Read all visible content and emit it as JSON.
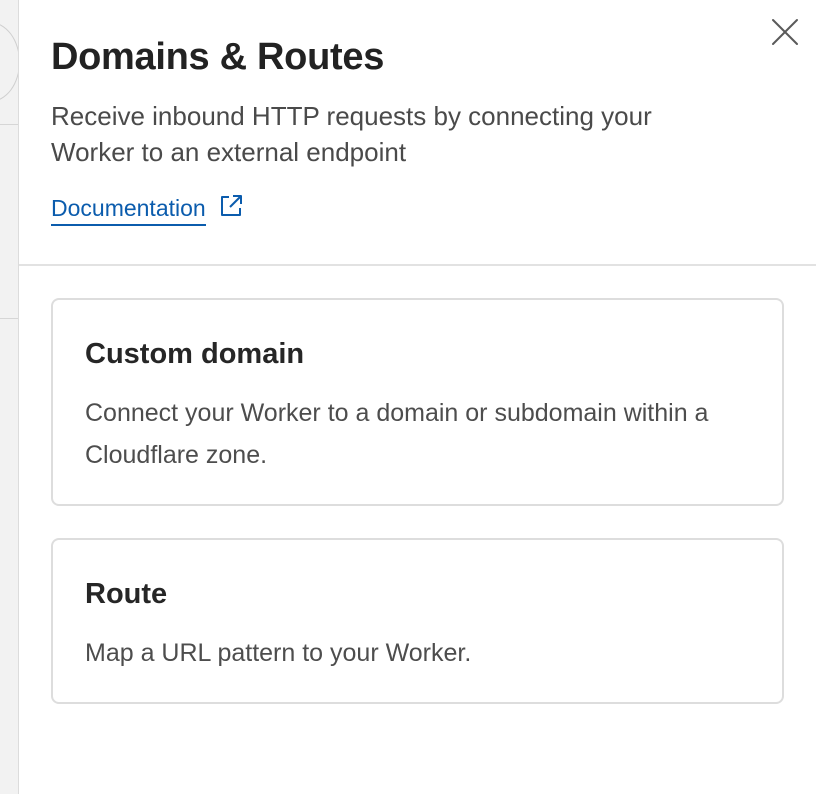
{
  "panel": {
    "title": "Domains & Routes",
    "subtitle": "Receive inbound HTTP requests by connecting your Worker to an external endpoint",
    "documentation_link": "Documentation",
    "close_icon": "close-icon",
    "external_link_icon": "external-link-icon"
  },
  "options": [
    {
      "title": "Custom domain",
      "description": "Connect your Worker to a domain or subdomain within a Cloudflare zone."
    },
    {
      "title": "Route",
      "description": "Map a URL pattern to your Worker."
    }
  ],
  "colors": {
    "link": "#0b5cad",
    "card_border": "#dddddd",
    "title_text": "#222222",
    "body_text": "#4a4a4a"
  }
}
